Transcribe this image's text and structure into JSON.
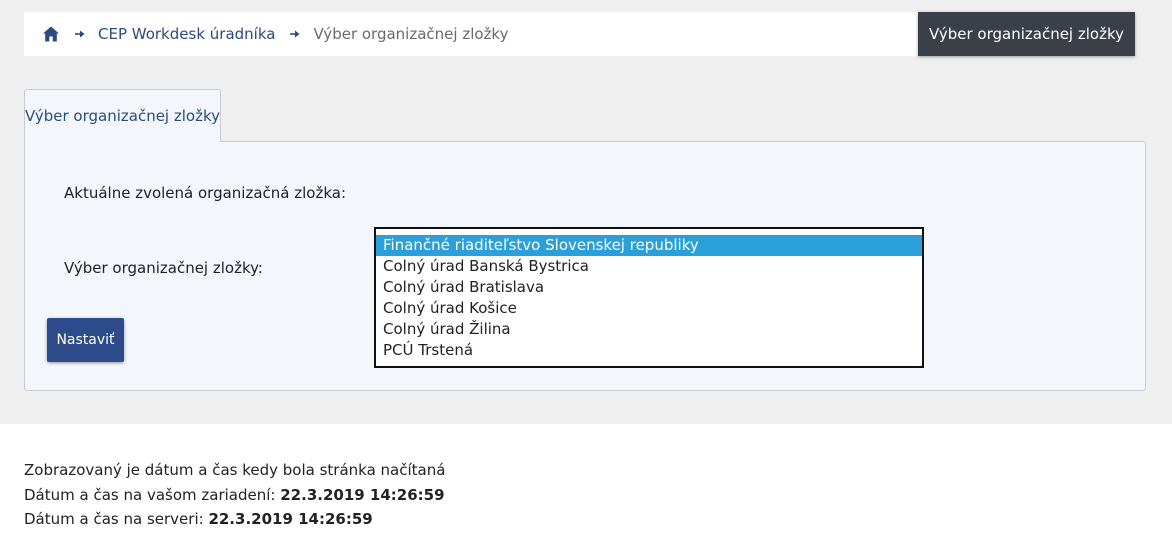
{
  "breadcrumb": {
    "items": [
      {
        "label": "CEP Workdesk úradníka"
      },
      {
        "label": "Výber organizačnej zložky"
      }
    ]
  },
  "page_title": "Výber organizačnej zložky",
  "tab": {
    "label": "Výber organizačnej zložky"
  },
  "form": {
    "current_label": "Aktuálne zvolená organizačná zložka:",
    "select_label": "Výber organizačnej zložky:",
    "options": [
      "Finančné riaditeľstvo Slovenskej republiky",
      "Colný úrad Banská Bystrica",
      "Colný úrad Bratislava",
      "Colný úrad Košice",
      "Colný úrad Žilina",
      "PCÚ Trstená"
    ],
    "selected_index": 0,
    "submit_label": "Nastaviť"
  },
  "footer": {
    "note": "Zobrazovaný je dátum a čas kedy bola stránka načítaná",
    "device_label": "Dátum a čas na vašom zariadení: ",
    "device_value": "22.3.2019 14:26:59",
    "server_label": "Dátum a čas na serveri: ",
    "server_value": "22.3.2019 14:26:59"
  },
  "colors": {
    "link": "#2c4a82",
    "title_box_bg": "#3a3f48",
    "button_bg": "#2d4a8a",
    "selected_option_bg": "#2b9fd9",
    "panel_bg": "#f3f7fc",
    "page_bg": "#efeff0"
  },
  "icons": {
    "home": "home-icon",
    "separator": "arrow-right-icon"
  }
}
